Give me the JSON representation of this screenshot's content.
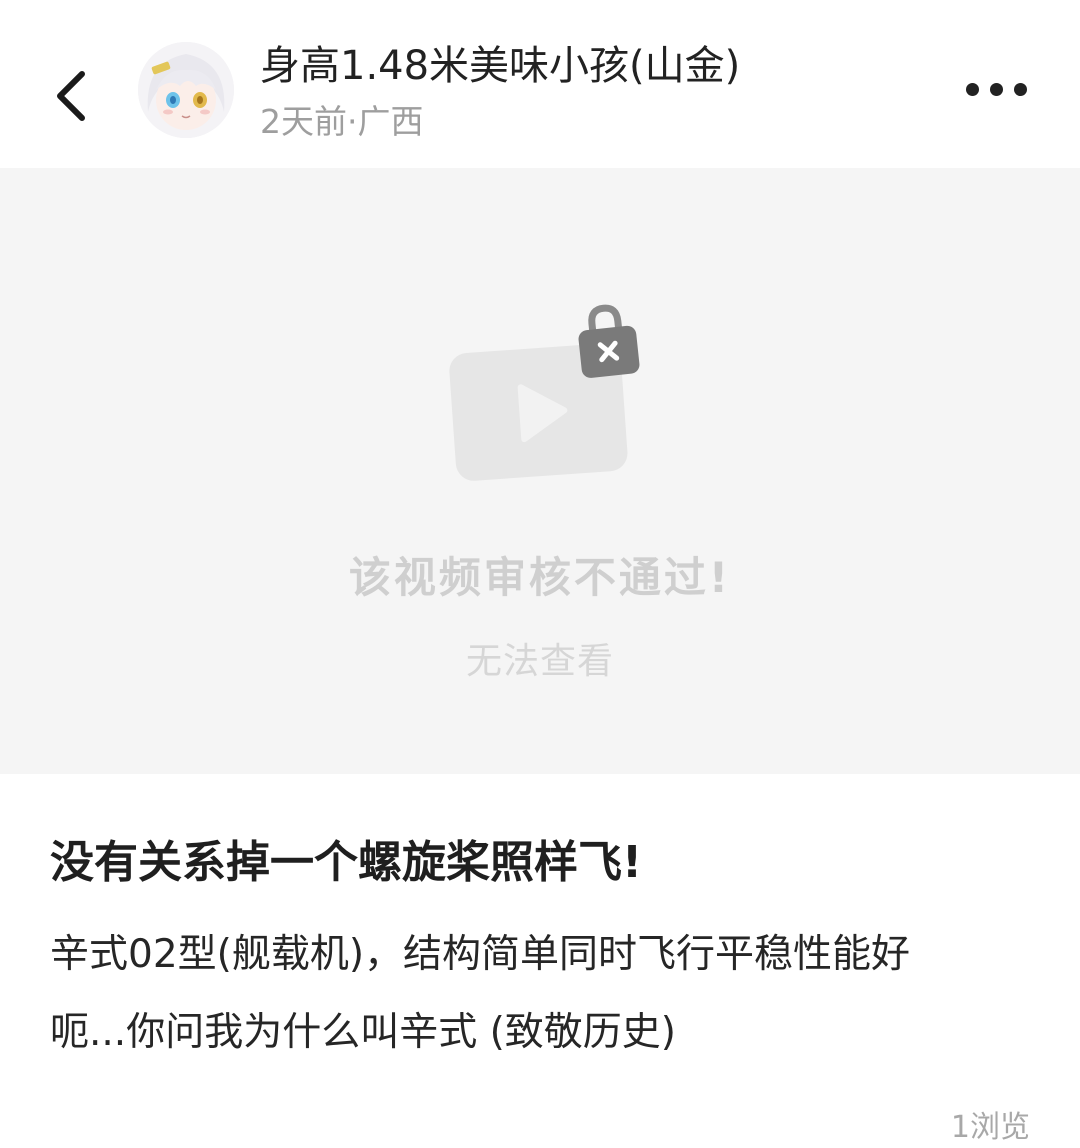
{
  "header": {
    "author_name": "身高1.48米美味小孩(山金)",
    "post_meta": "2天前·广西",
    "avatar_icon": "anime-girl-avatar",
    "back_icon": "chevron-left-icon",
    "more_icon": "more-horizontal-icon"
  },
  "video": {
    "status_title": "该视频审核不通过!",
    "status_subtitle": "无法查看",
    "icon": "locked-video-icon"
  },
  "post": {
    "title": "没有关系掉一个螺旋桨照样飞!",
    "body_lines": [
      "辛式02型(舰载机)，结构简单同时飞行平稳性能好",
      "呃...你问我为什么叫辛式 (致敬历史)"
    ],
    "view_count": "1浏览"
  },
  "colors": {
    "background": "#ffffff",
    "video_placeholder_bg": "#f5f5f5",
    "muted_text": "#9e9e9e",
    "blocked_text": "#cfcfcf",
    "lock_badge": "#7a7a7a"
  }
}
